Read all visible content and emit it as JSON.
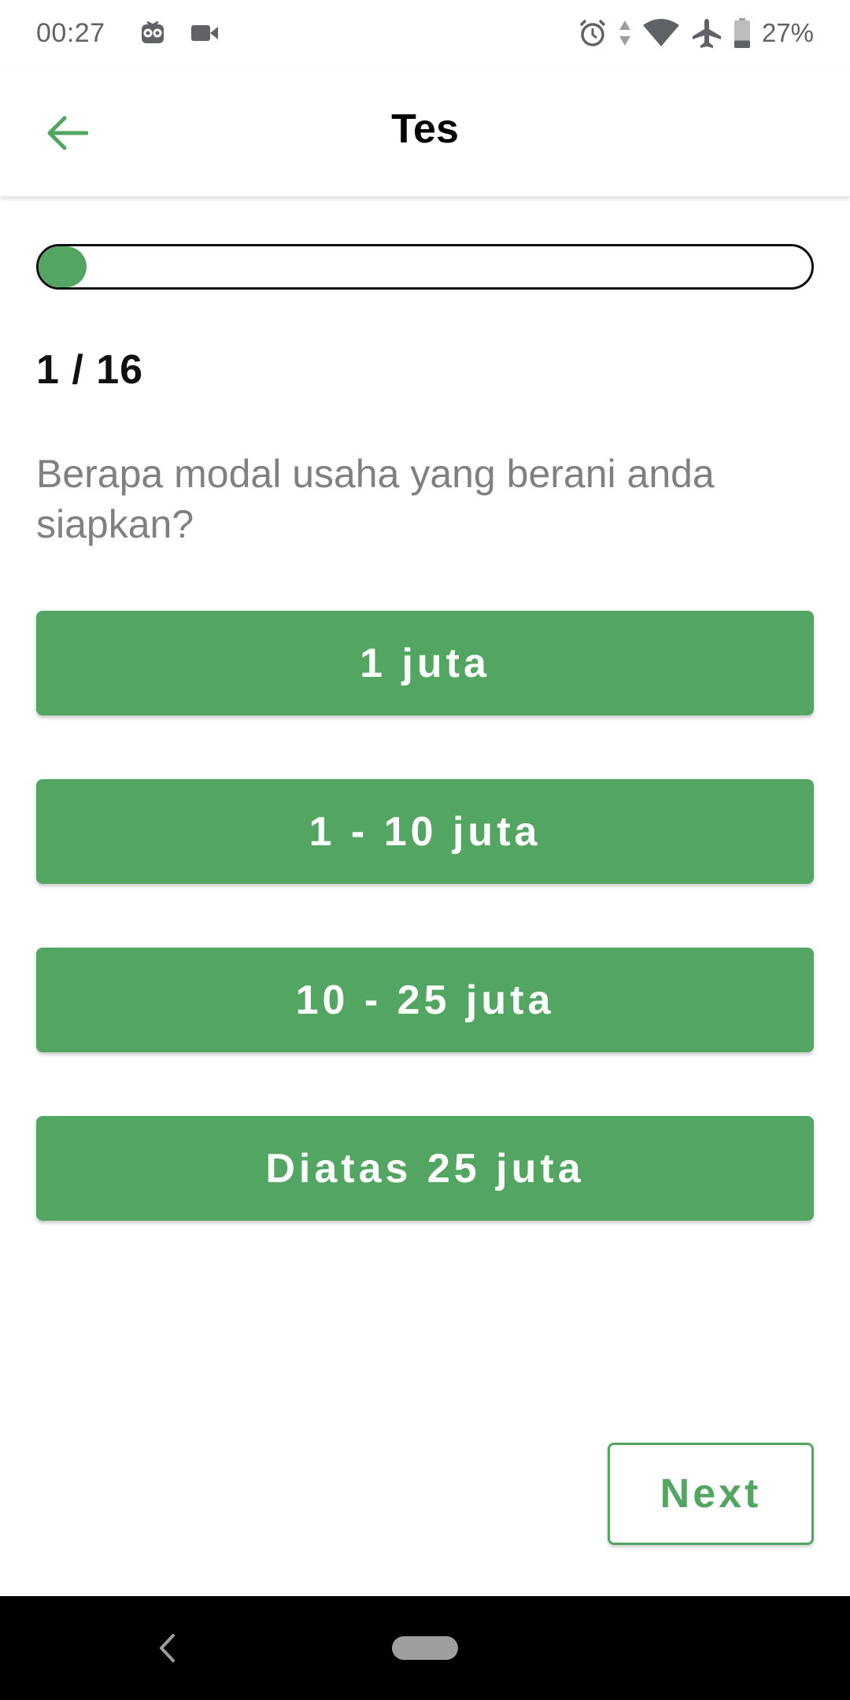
{
  "status_bar": {
    "time": "00:27",
    "battery_percent": "27%",
    "battery_level": 0.27,
    "icons": [
      "owl-icon",
      "video-camera-icon",
      "alarm-icon",
      "data-arrows-icon",
      "wifi-icon",
      "airplane-icon",
      "battery-icon"
    ]
  },
  "app_bar": {
    "title": "Tes",
    "back_icon": "arrow-left-icon"
  },
  "quiz": {
    "counter": "1 / 16",
    "progress": 0.0625,
    "question": "Berapa modal usaha yang berani anda siapkan?",
    "options": [
      "1 juta",
      "1 - 10 juta",
      "10 - 25 juta",
      "Diatas 25 juta"
    ],
    "next_label": "Next"
  },
  "colors": {
    "accent": "#53a661",
    "question_text": "#808080",
    "nav_bar": "#000000"
  },
  "nav_bar": {
    "back_icon": "chevron-left-icon",
    "home_icon": "home-pill-icon"
  }
}
